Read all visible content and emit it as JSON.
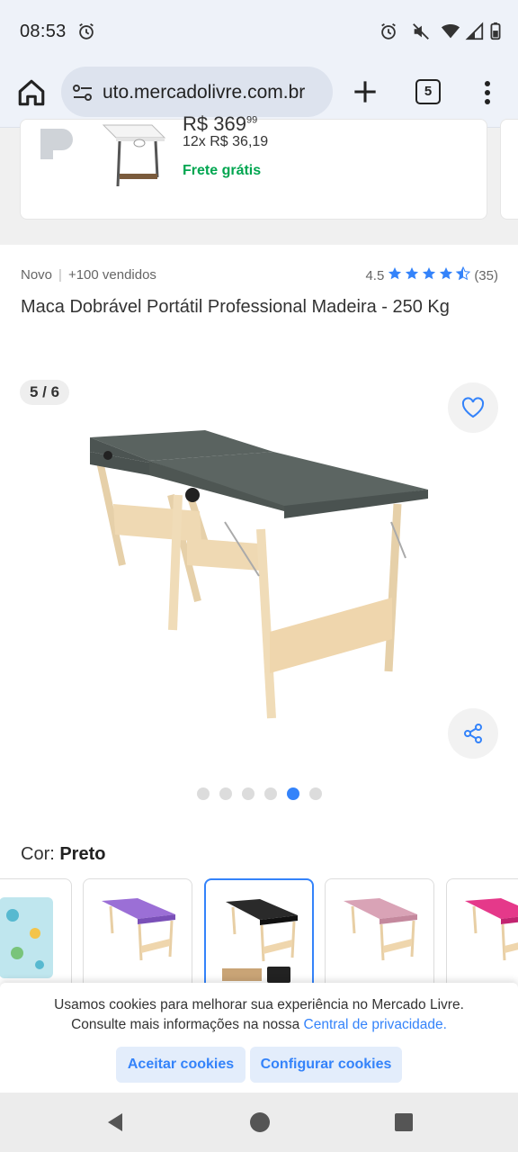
{
  "status": {
    "time": "08:53",
    "icons": [
      "alarm-icon",
      "alarm-icon",
      "mute-icon",
      "wifi-icon",
      "signal-icon",
      "battery-icon"
    ]
  },
  "browser": {
    "url": "uto.mercadolivre.com.br",
    "tab_count": "5"
  },
  "previous_card": {
    "price": "R$ 369",
    "price_cents": "99",
    "installments": "12x R$ 36,19",
    "shipping": "Frete grátis"
  },
  "product": {
    "condition": "Novo",
    "sold": "+100 vendidos",
    "rating": "4.5",
    "rating_stars": 4.5,
    "review_count": "(35)",
    "title": "Maca Dobrável Portátil Professional Madeira - 250 Kg"
  },
  "gallery": {
    "counter": "5 / 6",
    "total": 6,
    "active_index": 4
  },
  "color": {
    "label": "Cor: ",
    "selected": "Preto",
    "variants": [
      {
        "name": "estampada",
        "color": "#8fd3e0"
      },
      {
        "name": "lilás",
        "color": "#9b6fd6"
      },
      {
        "name": "preto",
        "color": "#2a2a2a"
      },
      {
        "name": "rosa",
        "color": "#d9a3b6"
      },
      {
        "name": "pink",
        "color": "#e5398a"
      }
    ]
  },
  "cookies": {
    "text_1": "Usamos cookies para melhorar sua experiência no Mercado Livre.",
    "text_2": "Consulte mais informações na nossa ",
    "link": "Central de privacidade.",
    "accept": "Aceitar cookies",
    "configure": "Configurar cookies"
  },
  "colors": {
    "accent": "#3483fa",
    "shipping_green": "#00a650",
    "table_top": "#5a6360",
    "wood": "#e8cfa5"
  }
}
